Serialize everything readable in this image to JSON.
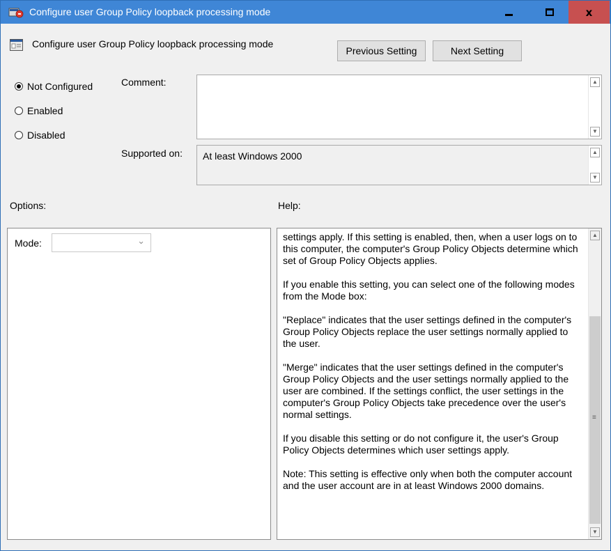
{
  "window": {
    "title": "Configure user Group Policy loopback processing mode",
    "controls": {
      "minimize": "minimize",
      "maximize": "maximize",
      "close": "x"
    }
  },
  "header": {
    "title": "Configure user Group Policy loopback processing mode",
    "previous_label": "Previous Setting",
    "next_label": "Next Setting"
  },
  "state": {
    "options": [
      {
        "label": "Not Configured",
        "selected": true
      },
      {
        "label": "Enabled",
        "selected": false
      },
      {
        "label": "Disabled",
        "selected": false
      }
    ]
  },
  "comment": {
    "label": "Comment:",
    "value": ""
  },
  "supported": {
    "label": "Supported on:",
    "value": "At least Windows 2000"
  },
  "options_section": {
    "label": "Options:",
    "mode_label": "Mode:",
    "mode_value": ""
  },
  "help": {
    "label": "Help:",
    "paragraphs": [
      "settings apply. If this setting is enabled, then, when a user logs on to this computer, the computer's Group Policy Objects determine which set of Group Policy Objects applies.",
      "If you enable this setting, you can select one of the following modes from the Mode box:",
      "\"Replace\" indicates that the user settings defined in the computer's Group Policy Objects replace the user settings normally applied to the user.",
      "\"Merge\" indicates that the user settings defined in the computer's Group Policy Objects and the user settings normally applied to the user are combined. If the settings conflict, the user settings in the computer's Group Policy Objects take precedence over the user's normal settings.",
      "If you disable this setting or do not configure it, the user's Group Policy Objects determines which user settings apply.",
      "Note: This setting is effective only when both the computer account and the user account are in at least Windows 2000 domains."
    ]
  },
  "colors": {
    "titlebar": "#3f86d6",
    "close_button": "#c75050",
    "dialog_background": "#f0f0f0"
  },
  "icons": {
    "title": "policy-window-icon",
    "header": "policy-setting-icon",
    "scroll_up": "chevron-up-icon",
    "scroll_down": "chevron-down-icon",
    "dropdown": "chevron-down-icon"
  }
}
